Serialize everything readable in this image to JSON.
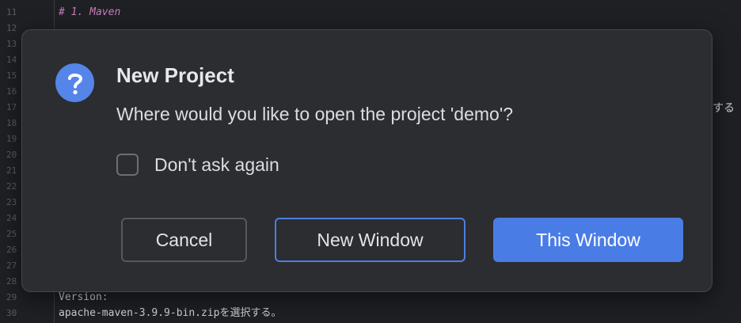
{
  "editor": {
    "line_numbers": [
      "11",
      "12",
      "13",
      "14",
      "15",
      "16",
      "17",
      "18",
      "19",
      "20",
      "21",
      "22",
      "23",
      "24",
      "25",
      "26",
      "27",
      "28",
      "29",
      "30"
    ],
    "heading_line": "# 1. Maven",
    "right_fragment": "する",
    "version_label": "Version:",
    "version_line": "apache-maven-3.9.9-bin.zipを選択する。"
  },
  "dialog": {
    "title": "New Project",
    "message": "Where would you like to open the project 'demo'?",
    "checkbox": {
      "label": "Don't ask again",
      "checked": false
    },
    "buttons": {
      "cancel": "Cancel",
      "new_window": "New Window",
      "this_window": "This Window"
    },
    "icon": "question-icon"
  },
  "colors": {
    "accent": "#4a7ce6",
    "icon_bg": "#5585e8",
    "dialog_bg": "#2b2d31",
    "editor_bg": "#1f2024",
    "heading_color": "#c77dbb"
  }
}
